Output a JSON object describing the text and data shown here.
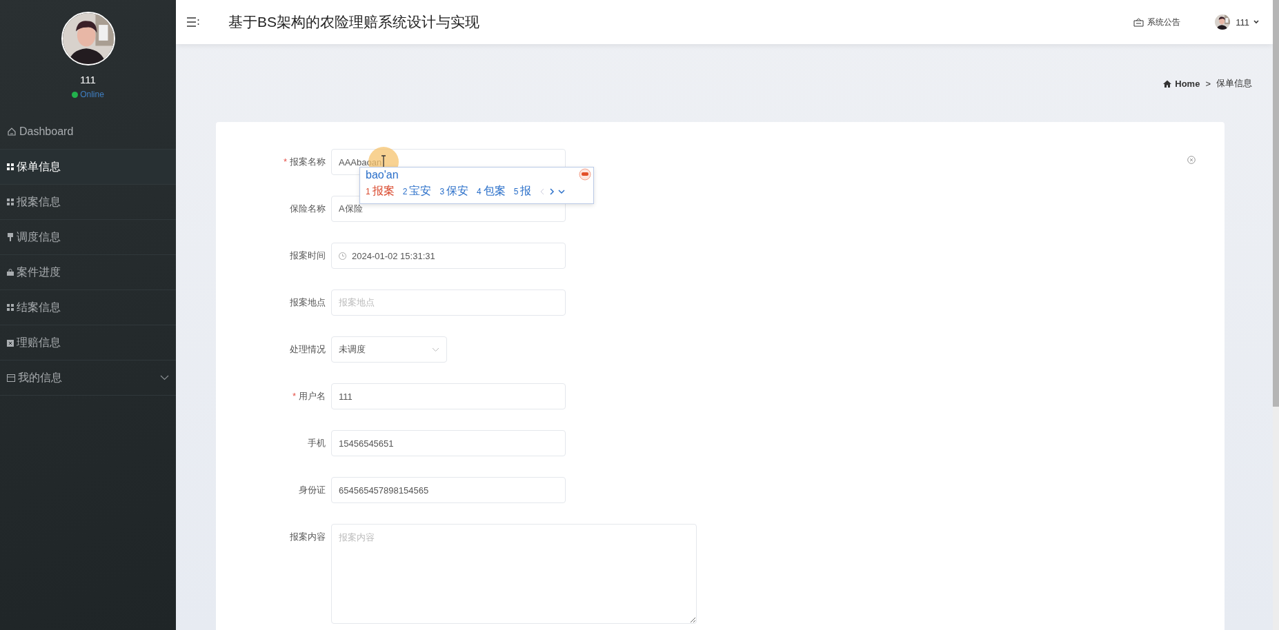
{
  "sidebar": {
    "user": {
      "name": "111",
      "status": "Online"
    },
    "items": [
      {
        "label": "Dashboard",
        "kind": "link",
        "selected": false
      },
      {
        "label": "保单信息",
        "kind": "link",
        "selected": true
      },
      {
        "label": "报案信息",
        "kind": "link",
        "selected": false
      },
      {
        "label": "调度信息",
        "kind": "link",
        "selected": false
      },
      {
        "label": "案件进度",
        "kind": "link",
        "selected": false
      },
      {
        "label": "结案信息",
        "kind": "link",
        "selected": false
      },
      {
        "label": "理赔信息",
        "kind": "link",
        "selected": false
      },
      {
        "label": "我的信息",
        "kind": "submenu",
        "selected": false
      }
    ]
  },
  "header": {
    "title": "基于BS架构的农险理赔系统设计与实现",
    "notice": "系统公告",
    "user": "111"
  },
  "breadcrumb": {
    "home": "Home",
    "separator": ">",
    "current": "保单信息"
  },
  "form": {
    "required_mark": "*",
    "fields": [
      {
        "label": "报案名称",
        "required": true,
        "kind": "text",
        "value": "AAAbaoan"
      },
      {
        "label": "保险名称",
        "required": false,
        "kind": "text",
        "value": "A保险"
      },
      {
        "label": "报案时间",
        "required": false,
        "kind": "datetime",
        "value": "2024-01-02 15:31:31"
      },
      {
        "label": "报案地点",
        "required": false,
        "kind": "text",
        "placeholder": "报案地点"
      },
      {
        "label": "处理情况",
        "required": false,
        "kind": "select",
        "value": "未调度"
      },
      {
        "label": "用户名",
        "required": true,
        "kind": "text",
        "value": "111"
      },
      {
        "label": "手机",
        "required": false,
        "kind": "text",
        "value": "15456545651"
      },
      {
        "label": "身份证",
        "required": false,
        "kind": "text",
        "value": "654565457898154565"
      },
      {
        "label": "报案内容",
        "required": false,
        "kind": "textarea",
        "placeholder": "报案内容"
      }
    ]
  },
  "ime": {
    "composition": "bao'an",
    "candidates": [
      {
        "index": "1",
        "text": "报案",
        "selected": true
      },
      {
        "index": "2",
        "text": "宝安",
        "selected": false
      },
      {
        "index": "3",
        "text": "保安",
        "selected": false
      },
      {
        "index": "4",
        "text": "包案",
        "selected": false
      },
      {
        "index": "5",
        "text": "报",
        "selected": false
      }
    ]
  }
}
